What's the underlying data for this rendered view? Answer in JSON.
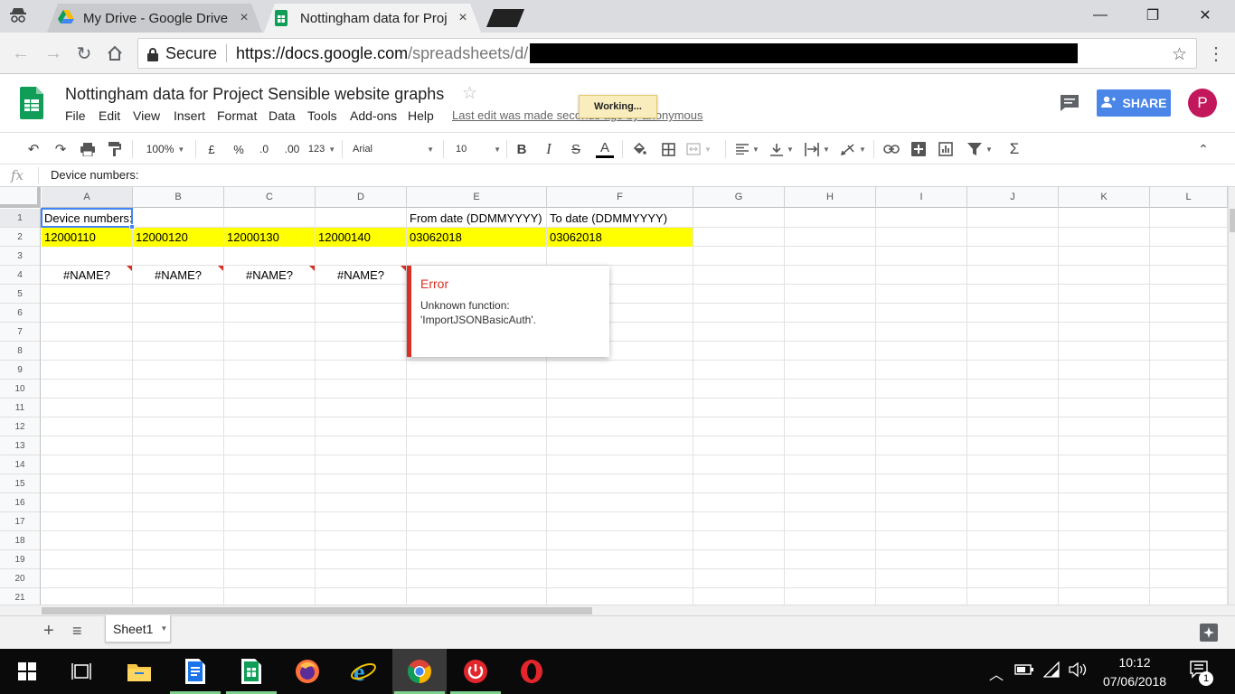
{
  "browser": {
    "tabs": [
      {
        "label": "My Drive - Google Drive",
        "close": "×"
      },
      {
        "label": "Nottingham data for Proj",
        "close": "×"
      }
    ],
    "window_controls": {
      "minimize": "—",
      "maximize": "❐",
      "close": "✕"
    },
    "secure_label": "Secure",
    "url_host": "https://docs.google.com",
    "url_path": "/spreadsheets/d/"
  },
  "doc": {
    "title": "Nottingham data for Project Sensible website graphs",
    "menu": [
      "File",
      "Edit",
      "View",
      "Insert",
      "Format",
      "Data",
      "Tools",
      "Add-ons",
      "Help"
    ],
    "last_edit": "Last edit was made seconds ago by anonymous",
    "working": "Working...",
    "share": "SHARE",
    "avatar_letter": "P"
  },
  "toolbar": {
    "zoom": "100%",
    "currency": "£",
    "percent": "%",
    "dec_less": ".0",
    "dec_more": ".00",
    "more_formats": "123",
    "font": "Arial",
    "font_size": "10",
    "bold": "B",
    "italic": "I",
    "strike": "S",
    "text_color": "A",
    "sum": "Σ"
  },
  "formula_bar": {
    "fx": "fx",
    "value": "Device numbers:"
  },
  "grid": {
    "columns": [
      "A",
      "B",
      "C",
      "D",
      "E",
      "F",
      "G",
      "H",
      "I",
      "J",
      "K",
      "L"
    ],
    "rows": [
      "1",
      "2",
      "3",
      "4",
      "5",
      "6",
      "7",
      "8",
      "9",
      "10",
      "11",
      "12",
      "13",
      "14",
      "15",
      "16",
      "17",
      "18",
      "19",
      "20",
      "21"
    ],
    "cells": {
      "A1": "Device numbers:",
      "E1": "From date (DDMMYYYY)",
      "F1": "To date (DDMMYYYY)",
      "A2": "12000110",
      "B2": "12000120",
      "C2": "12000130",
      "D2": "12000140",
      "E2": "03062018",
      "F2": "03062018",
      "A4": "#NAME?",
      "B4": "#NAME?",
      "C4": "#NAME?",
      "D4": "#NAME?"
    },
    "highlight_color": "#ffff00"
  },
  "error_popup": {
    "title": "Error",
    "message": "Unknown function: 'ImportJSONBasicAuth'."
  },
  "sheets": {
    "add": "+",
    "list": "≡",
    "tabs": [
      "Sheet1"
    ]
  },
  "taskbar": {
    "time": "10:12",
    "date": "07/06/2018",
    "notification_count": "1"
  },
  "colors": {
    "share_blue": "#4a86e8",
    "error_red": "#d93025",
    "sheets_green": "#0f9d58",
    "avatar": "#c2185b"
  }
}
